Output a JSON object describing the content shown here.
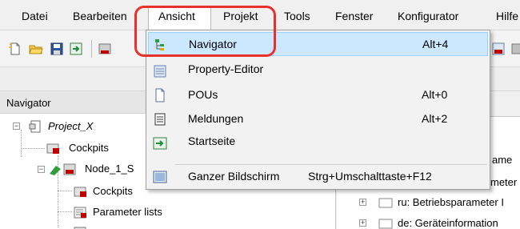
{
  "menubar": {
    "items": [
      {
        "label": "Datei"
      },
      {
        "label": "Bearbeiten"
      },
      {
        "label": "Ansicht"
      },
      {
        "label": "Projekt"
      },
      {
        "label": "Tools"
      },
      {
        "label": "Fenster"
      },
      {
        "label": "Konfigurator"
      },
      {
        "label": "Hilfe"
      }
    ]
  },
  "toolbar": {
    "icons": [
      "new-file-icon",
      "open-folder-icon",
      "save-icon",
      "import-icon",
      "device-icon",
      "config-icon",
      "device-icon"
    ]
  },
  "dropdown": {
    "items": [
      {
        "label": "Navigator",
        "shortcut": "Alt+4",
        "icon": "navigator-tree-icon"
      },
      {
        "label": "Property-Editor",
        "shortcut": "",
        "icon": "property-editor-icon"
      },
      {
        "label": "POUs",
        "shortcut": "Alt+0",
        "icon": "pou-page-icon"
      },
      {
        "label": "Meldungen",
        "shortcut": "Alt+2",
        "icon": "messages-icon"
      },
      {
        "label": "Startseite",
        "shortcut": "",
        "icon": "startpage-arrow-icon"
      },
      {
        "label": "Ganzer Bildschirm",
        "shortcut": "Strg+Umschalttaste+F12",
        "icon": "fullscreen-icon"
      }
    ]
  },
  "navigator": {
    "title": "Navigator",
    "tree": [
      {
        "label": "Project_X",
        "italic": true,
        "icon": "project-icon"
      },
      {
        "label": "Cockpits",
        "icon": "cockpit-icon"
      },
      {
        "label": "Node_1_S",
        "icon": "node-device-icon"
      },
      {
        "label": "Cockpits",
        "icon": "cockpit-icon"
      },
      {
        "label": "Parameter lists",
        "icon": "parameter-list-icon"
      }
    ]
  },
  "right_panel": {
    "tab_fragment": "gen",
    "rows": [
      {
        "label": "ame"
      },
      {
        "label": "meter"
      },
      {
        "label": "ru: Betriebsparameter I"
      },
      {
        "label": "de: Geräteinformation"
      }
    ]
  },
  "colors": {
    "highlight_border": "#e8302c",
    "selected_bg": "#cce8ff",
    "selected_border": "#99d1ff"
  }
}
